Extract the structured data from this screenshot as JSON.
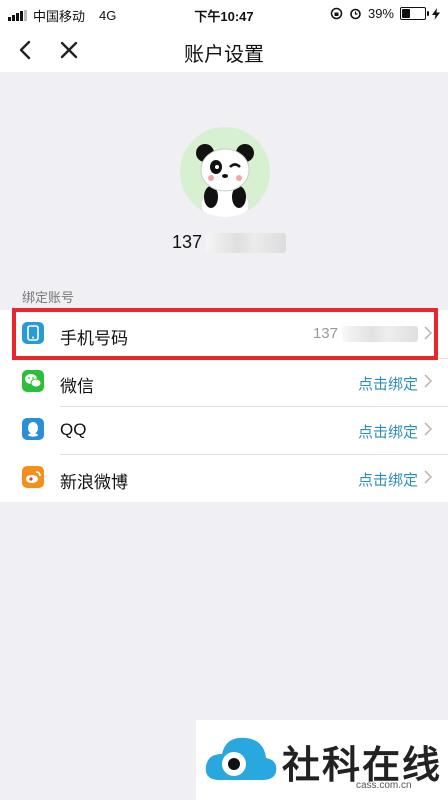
{
  "status_bar": {
    "carrier": "中国移动",
    "network": "4G",
    "time": "下午10:47",
    "battery_percent": "39%",
    "battery_level": 0.39
  },
  "nav": {
    "title": "账户设置"
  },
  "profile": {
    "username_prefix": "137"
  },
  "bind_section": {
    "label": "绑定账号",
    "items": [
      {
        "label": "手机号码",
        "value": "137",
        "icon": "phone-icon",
        "color": "#2a9ad6"
      },
      {
        "label": "微信",
        "value": "点击绑定",
        "icon": "wechat-icon",
        "color": "#2dbf3a"
      },
      {
        "label": "QQ",
        "value": "点击绑定",
        "icon": "qq-icon",
        "color": "#2a8fd6"
      },
      {
        "label": "新浪微博",
        "value": "点击绑定",
        "icon": "weibo-icon",
        "color": "#f2901e"
      }
    ]
  },
  "watermark": {
    "brand": "社科在线",
    "domain": "cass.com.cn"
  },
  "colors": {
    "highlight": "#e8262b",
    "link": "#2a8fbd"
  }
}
